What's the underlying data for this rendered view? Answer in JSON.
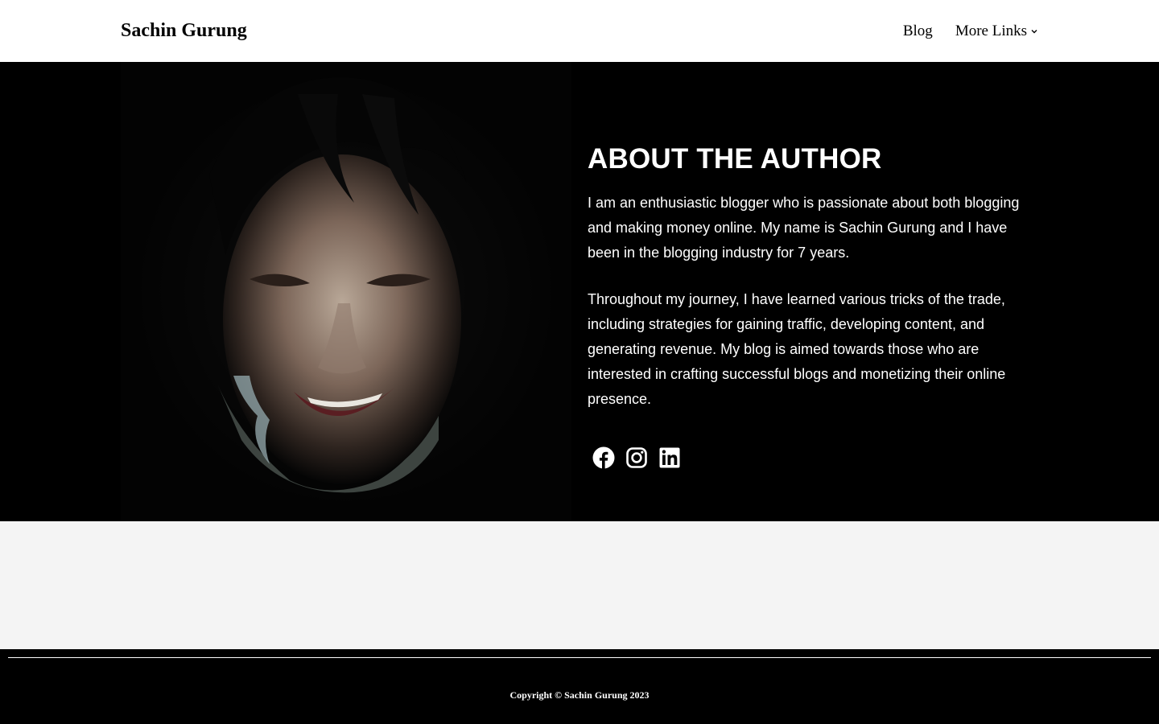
{
  "header": {
    "site_title": "Sachin Gurung",
    "nav": {
      "blog": "Blog",
      "more_links": "More Links"
    }
  },
  "hero": {
    "heading": "ABOUT THE AUTHOR",
    "paragraphs": [
      "I am an enthusiastic blogger who is passionate about both blogging and making money online. My name is Sachin Gurung and I have been in the blogging industry for 7 years.",
      "Throughout my journey, I have learned various tricks of the trade, including strategies for gaining traffic, developing content, and generating revenue. My blog is aimed towards those who are interested in crafting successful blogs and monetizing their online presence."
    ],
    "social": [
      {
        "icon": "facebook-icon"
      },
      {
        "icon": "instagram-icon"
      },
      {
        "icon": "linkedin-icon"
      }
    ]
  },
  "footer": {
    "copyright": "Copyright © Sachin Gurung 2023"
  },
  "colors": {
    "header_bg": "#ffffff",
    "hero_bg": "#000000",
    "band_bg": "#f4f4f4",
    "footer_bg": "#000000",
    "text_light": "#ffffff",
    "text_dark": "#000000"
  }
}
